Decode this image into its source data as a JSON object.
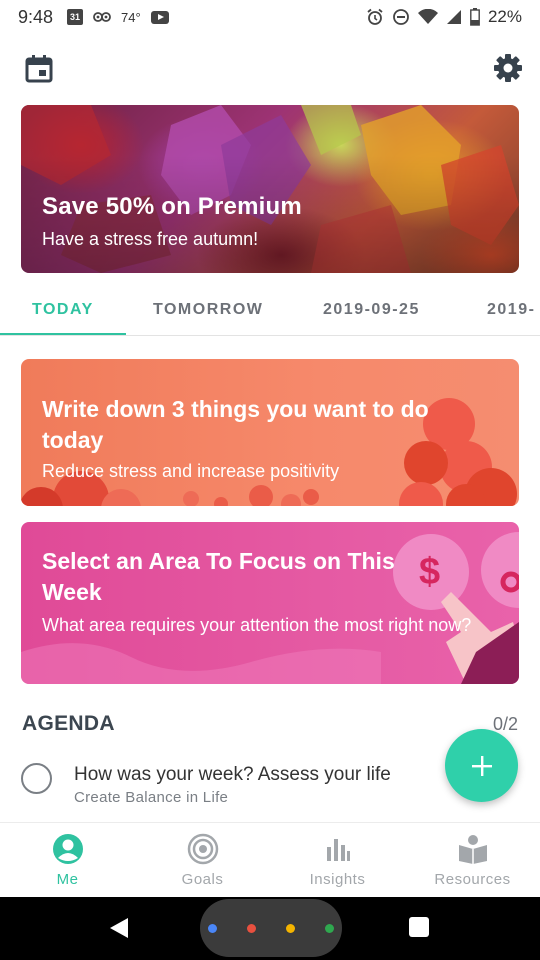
{
  "status_bar": {
    "time": "9:48",
    "calendar_day": "31",
    "temperature": "74°",
    "battery": "22%"
  },
  "promo": {
    "title": "Save 50% on Premium",
    "subtitle": "Have a stress free autumn!"
  },
  "tabs": [
    {
      "label": "TODAY",
      "active": true
    },
    {
      "label": "TOMORROW",
      "active": false
    },
    {
      "label": "2019-09-25",
      "active": false
    },
    {
      "label": "2019-",
      "active": false
    }
  ],
  "cards": [
    {
      "title": "Write down 3 things you want to do today",
      "subtitle": "Reduce stress and increase positivity",
      "color": "#f5876a"
    },
    {
      "title": "Select an Area To Focus on This Week",
      "subtitle": "What area requires your attention the most right now?",
      "color": "#e4559f"
    }
  ],
  "agenda": {
    "title": "AGENDA",
    "count": "0/2",
    "items": [
      {
        "title": "How was your week? Assess your life",
        "subtitle": "Create Balance in Life",
        "checked": false
      }
    ]
  },
  "fab": {
    "icon": "plus-icon",
    "color": "#2fd0aa"
  },
  "bottom_nav": [
    {
      "label": "Me",
      "icon": "person-icon",
      "active": true
    },
    {
      "label": "Goals",
      "icon": "target-icon",
      "active": false
    },
    {
      "label": "Insights",
      "icon": "bar-chart-icon",
      "active": false
    },
    {
      "label": "Resources",
      "icon": "resources-icon",
      "active": false
    }
  ],
  "colors": {
    "accent": "#2fc2a0",
    "inactive": "#a3a7ab"
  }
}
